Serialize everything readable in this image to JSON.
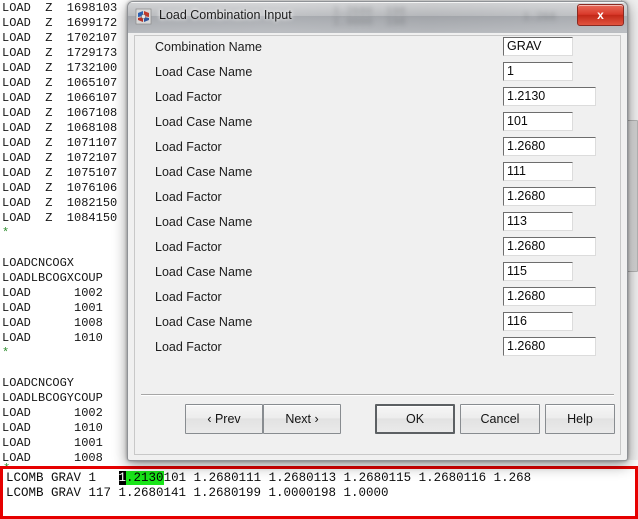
{
  "editor": {
    "lines": [
      "LOAD  Z  1698103",
      "LOAD  Z  1699172",
      "LOAD  Z  1702107",
      "LOAD  Z  1729173",
      "LOAD  Z  1732100",
      "LOAD  Z  1065107",
      "LOAD  Z  1066107",
      "LOAD  Z  1067108",
      "LOAD  Z  1068108",
      "LOAD  Z  1071107",
      "LOAD  Z  1072107",
      "LOAD  Z  1075107",
      "LOAD  Z  1076106",
      "LOAD  Z  1082150",
      "LOAD  Z  1084150",
      "*",
      "",
      "LOADCNCOGX",
      "LOADLBCOGXCOUP",
      "LOAD      1002",
      "LOAD      1001",
      "LOAD      1008",
      "LOAD      1010",
      "*",
      "",
      "LOADCNCOGY",
      "LOADLBCOGYCOUP",
      "LOAD      1002",
      "LOAD      1010",
      "LOAD      1001",
      "LOAD      1008",
      "LCOMB",
      "*"
    ],
    "star_marker": "*",
    "star_color": "#2f8f2f"
  },
  "output_pane": {
    "border_color": "#e60000",
    "line1": {
      "prefix": "LCOMB GRAV 1   ",
      "cursor_char": "1",
      "highlight_text": ".2130",
      "highlight_color": "#19e519",
      "suffix": "101 1.2680111 1.2680113 1.2680115 1.2680116 1.268"
    },
    "line2": "LCOMB GRAV 117 1.2680141 1.2680199 1.0000198 1.0000",
    "trailing_star": "*"
  },
  "dialog": {
    "title": "Load Combination Input",
    "icon": "app-icon",
    "close_label": "x",
    "close_color": "#d9392a",
    "fields": [
      {
        "label": "Combination Name",
        "value": "GRAV",
        "width": "narrow"
      },
      {
        "label": "Load Case Name",
        "value": "1",
        "width": "narrow"
      },
      {
        "label": "Load Factor",
        "value": "1.2130",
        "width": "wide"
      },
      {
        "label": "Load Case Name",
        "value": "101",
        "width": "narrow"
      },
      {
        "label": "Load Factor",
        "value": "1.2680",
        "width": "wide"
      },
      {
        "label": "Load Case Name",
        "value": "111",
        "width": "narrow"
      },
      {
        "label": "Load Factor",
        "value": "1.2680",
        "width": "wide"
      },
      {
        "label": "Load Case Name",
        "value": "113",
        "width": "narrow"
      },
      {
        "label": "Load Factor",
        "value": "1.2680",
        "width": "wide"
      },
      {
        "label": "Load Case Name",
        "value": "115",
        "width": "narrow"
      },
      {
        "label": "Load Factor",
        "value": "1.2680",
        "width": "wide"
      },
      {
        "label": "Load Case Name",
        "value": "116",
        "width": "narrow"
      },
      {
        "label": "Load Factor",
        "value": "1.2680",
        "width": "wide"
      }
    ],
    "buttons": {
      "prev": "‹ Prev",
      "next": "Next ›",
      "ok": "OK",
      "cancel": "Cancel",
      "help": "Help"
    }
  }
}
